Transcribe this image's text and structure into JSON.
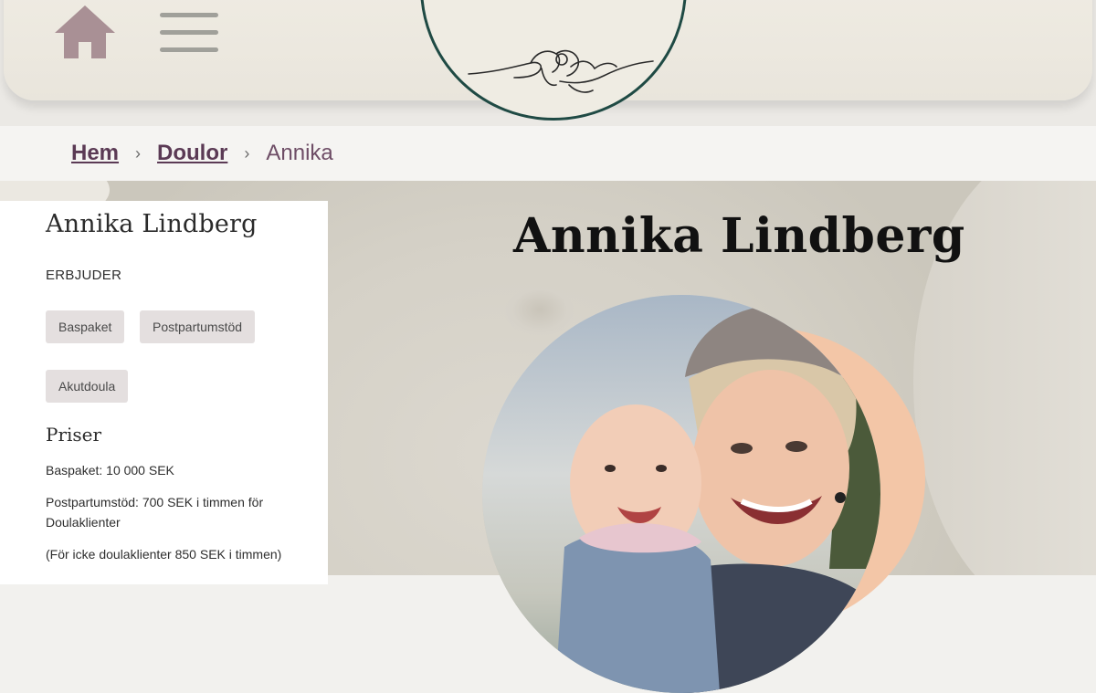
{
  "header": {
    "home_icon": "home-icon",
    "menu_icon": "hamburger-menu-icon",
    "logo": "doula-hands-logo"
  },
  "breadcrumb": {
    "home": "Hem",
    "section": "Doulor",
    "current": "Annika",
    "separator": "›"
  },
  "sidebar": {
    "name": "Annika Lindberg",
    "offers_heading": "ERBJUDER",
    "tags": [
      "Baspaket",
      "Postpartumstöd",
      "Akutdoula"
    ],
    "prices_heading": "Priser",
    "prices": [
      "Baspaket: 10 000 SEK",
      "Postpartumstöd: 700 SEK i timmen för Doulaklienter",
      "(För icke doulaklienter 850 SEK i timmen)"
    ]
  },
  "main": {
    "name": "Annika Lindberg",
    "photo": "profile-photo"
  },
  "colors": {
    "brand_plum": "#5b3a55",
    "logo_green": "#1f4a44",
    "accent_peach": "#f3c6a7",
    "tag_bg": "#e4dfdf"
  }
}
